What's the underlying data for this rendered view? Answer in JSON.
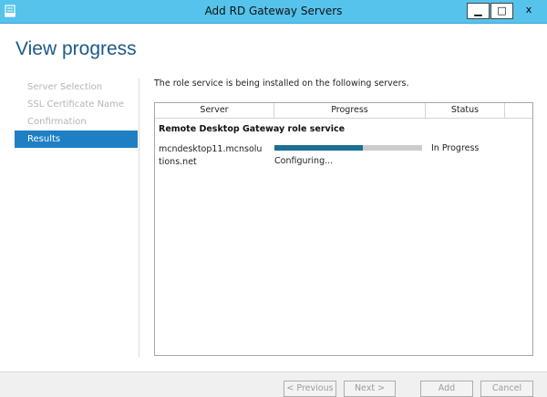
{
  "window": {
    "title": "Add RD Gateway Servers",
    "icon": "server-manager-icon",
    "controls": {
      "minimize": "▁",
      "maximize": "□",
      "close": "x"
    }
  },
  "header": {
    "title": "View progress"
  },
  "nav": {
    "items": [
      {
        "label": "Server Selection",
        "active": false
      },
      {
        "label": "SSL Certificate Name",
        "active": false
      },
      {
        "label": "Confirmation",
        "active": false
      },
      {
        "label": "Results",
        "active": true
      }
    ]
  },
  "main": {
    "intro": "The role service is being installed on the following servers.",
    "table": {
      "columns": [
        "Server",
        "Progress",
        "Status"
      ],
      "group_label": "Remote Desktop Gateway role service",
      "rows": [
        {
          "server": "mcndesktop11.mcnsolutions.net",
          "progress": 0.6,
          "progress_text": "Configuring...",
          "status": "In Progress"
        }
      ]
    }
  },
  "footer": {
    "previous": "< Previous",
    "next": "Next >",
    "add": "Add",
    "cancel": "Cancel"
  },
  "colors": {
    "titlebar": "#55c3ec",
    "accent": "#1e7fc4",
    "progress_fill": "#1b6f91",
    "header_text": "#1c5a8a"
  }
}
